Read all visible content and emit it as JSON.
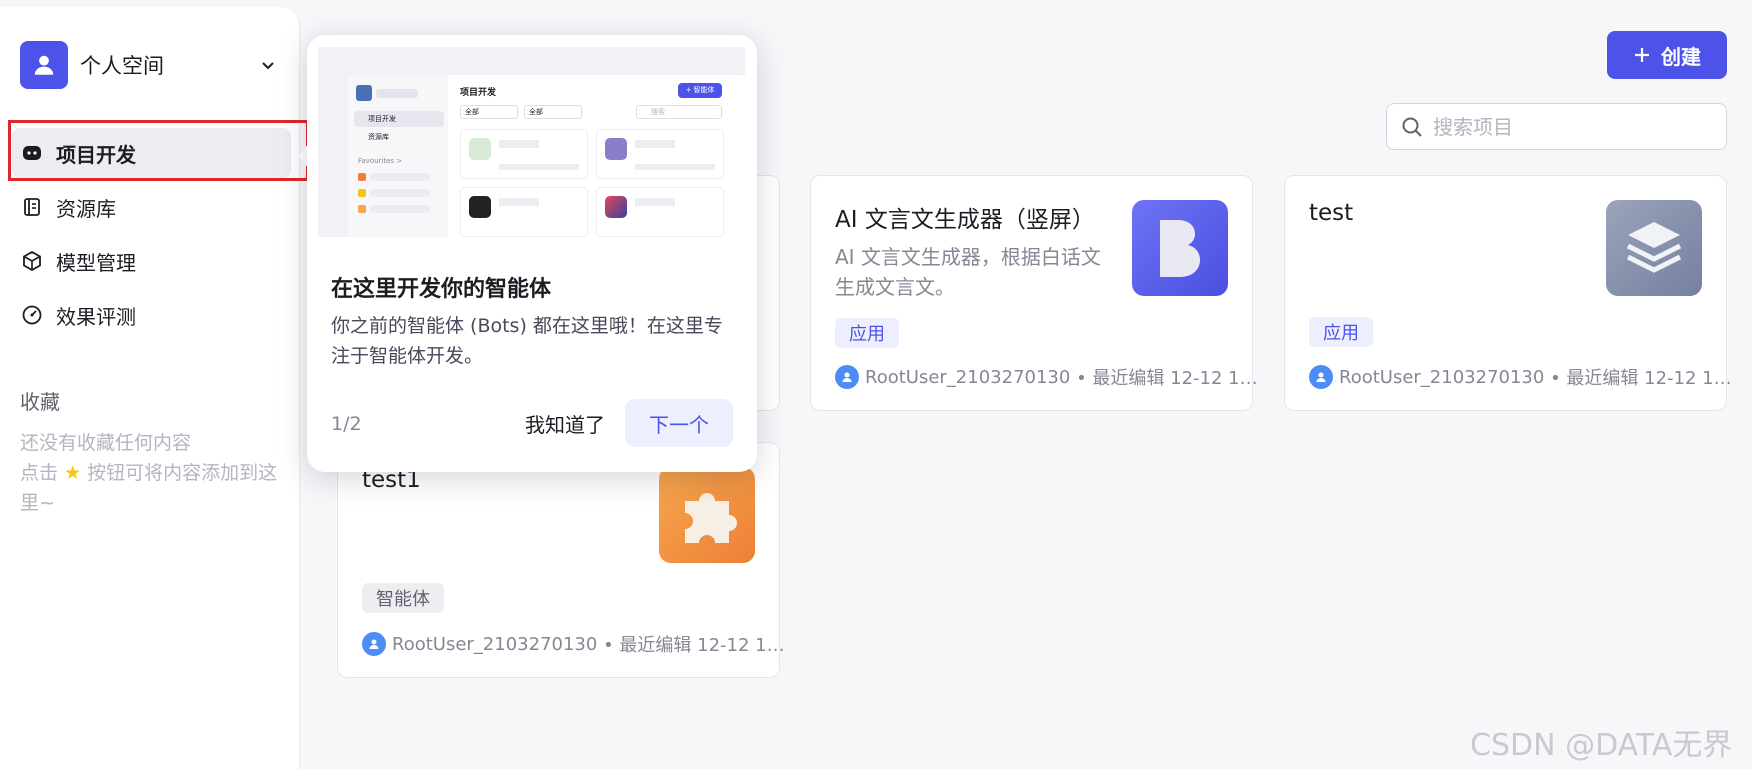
{
  "space": {
    "name": "个人空间"
  },
  "sidebar": {
    "items": [
      {
        "label": "项目开发",
        "icon": "project-dev-icon",
        "active": true
      },
      {
        "label": "资源库",
        "icon": "library-icon"
      },
      {
        "label": "模型管理",
        "icon": "model-icon"
      },
      {
        "label": "效果评测",
        "icon": "evaluation-icon"
      }
    ],
    "favorites_title": "收藏",
    "favorites_empty_line1": "还没有收藏任何内容",
    "favorites_empty_line2a": "点击",
    "favorites_empty_line2b": "按钮可将内容添加到这里~"
  },
  "toolbar": {
    "create_label": "创建",
    "search_placeholder": "搜索项目"
  },
  "cards": [
    {
      "title": "AI 文言文生成器（竖屏）",
      "desc": "AI 文言文生成器，根据白话文生成文言文。",
      "tag": "应用",
      "author": "RootUser_2103270130",
      "meta": "• 最近编辑 12-12 1…",
      "thumb_color": "#5a5ff0"
    },
    {
      "title": "test",
      "desc": "",
      "tag": "应用",
      "author": "RootUser_2103270130",
      "meta": "• 最近编辑 12-12 1…",
      "thumb_color": "#8a95ad"
    },
    {
      "title": "test1",
      "desc": "",
      "tag": "智能体",
      "author": "RootUser_2103270130",
      "meta": "• 最近编辑 12-12 1…",
      "thumb_color": "#f0923c"
    }
  ],
  "popover": {
    "title": "在这里开发你的智能体",
    "desc": "你之前的智能体 (Bots) 都在这里哦！在这里专注于智能体开发。",
    "step": "1/2",
    "dismiss_label": "我知道了",
    "next_label": "下一个",
    "preview": {
      "page_title": "项目开发",
      "create_label": "+ 智能体",
      "filter1": "全部",
      "filter2": "全部",
      "search": "搜索",
      "nav1": "项目开发",
      "nav2": "资源库",
      "fav": "Favourites >"
    }
  },
  "watermark": "CSDN @DATA无界",
  "colors": {
    "accent": "#4d53e8",
    "highlight_border": "#e0252b"
  }
}
